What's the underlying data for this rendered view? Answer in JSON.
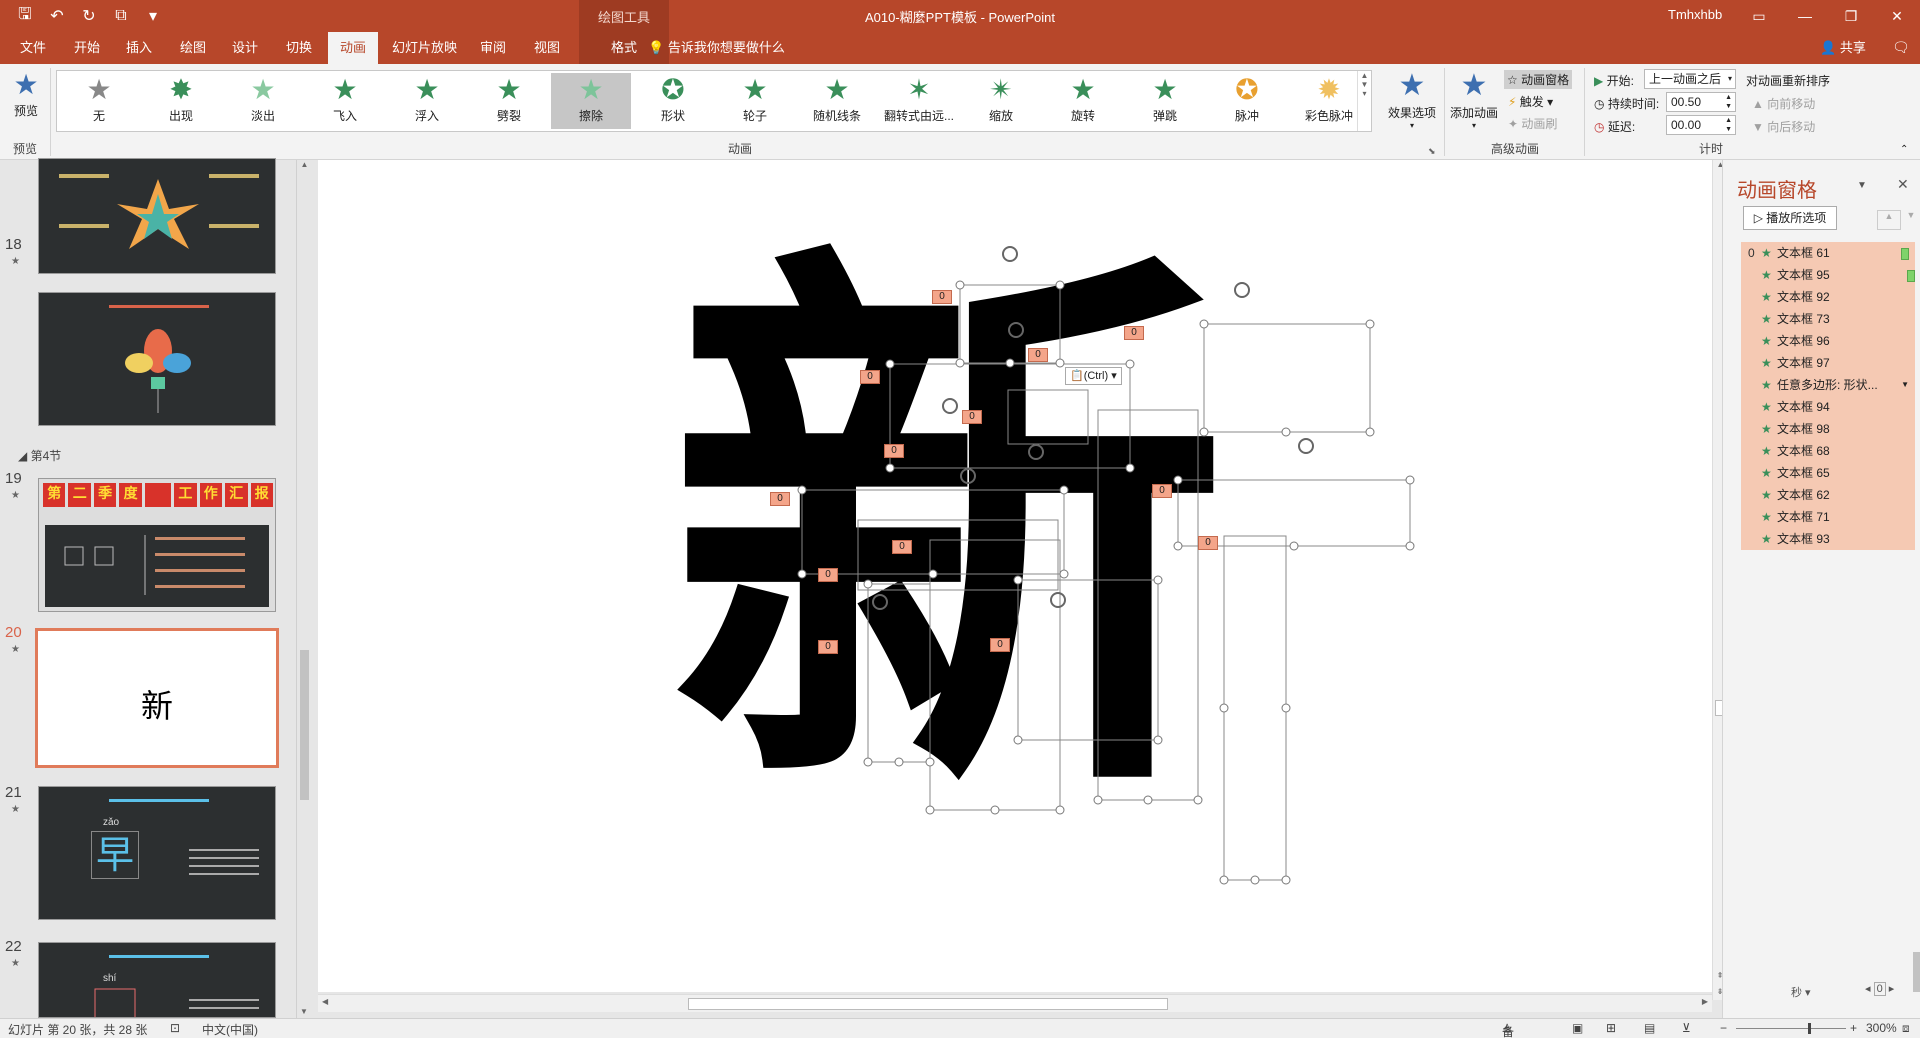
{
  "titlebar": {
    "context_tools": "绘图工具",
    "title": "A010-糊麼PPT模板 - PowerPoint",
    "user": "Tmhxhbb"
  },
  "tabs": [
    "文件",
    "开始",
    "插入",
    "绘图",
    "设计",
    "切换",
    "动画",
    "幻灯片放映",
    "审阅",
    "视图",
    "格式"
  ],
  "tell_me": "告诉我你想要做什么",
  "share": "共享",
  "ribbon": {
    "preview_label": "预览",
    "preview_group": "预览",
    "animation_group": "动画",
    "advanced_group": "高级动画",
    "timing_group": "计时",
    "gallery": [
      "无",
      "出现",
      "淡出",
      "飞入",
      "浮入",
      "劈裂",
      "擦除",
      "形状",
      "轮子",
      "随机线条",
      "翻转式由远...",
      "缩放",
      "旋转",
      "弹跳",
      "脉冲",
      "彩色脉冲"
    ],
    "selected_effect": "擦除",
    "effect_options": "效果选项",
    "add_animation": "添加动画",
    "animation_pane_btn": "动画窗格",
    "trigger": "触发",
    "animation_painter": "动画刷",
    "start_label": "开始:",
    "start_value": "上一动画之后",
    "duration_label": "持续时间:",
    "duration_value": "00.50",
    "delay_label": "延迟:",
    "delay_value": "00.00",
    "reorder_title": "对动画重新排序",
    "move_earlier": "向前移动",
    "move_later": "向后移动"
  },
  "slides": {
    "section": "第4节",
    "numbers": [
      "18",
      "19",
      "20",
      "21",
      "22"
    ],
    "current_slide_text": "新",
    "thumb_19_title": [
      "第",
      "二",
      "季",
      "度",
      "工",
      "作",
      "汇",
      "报"
    ],
    "thumb_21_char": "早",
    "thumb_21_pinyin": "zǎo",
    "thumb_22_pinyin": "shí"
  },
  "slide": {
    "character": "新",
    "ctrl_tag": "(Ctrl)",
    "anim_tag": "0"
  },
  "animation_pane": {
    "title": "动画窗格",
    "play_selected": "播放所选项",
    "first_index": "0",
    "items": [
      "文本框 61",
      "文本框 95",
      "文本框 92",
      "文本框 73",
      "文本框 96",
      "文本框 97",
      "任意多边形: 形状...",
      "文本框 94",
      "文本框 98",
      "文本框 68",
      "文本框 65",
      "文本框 62",
      "文本框 71",
      "文本框 93"
    ],
    "seconds_label": "秒",
    "zoom_index": "0"
  },
  "statusbar": {
    "slide_info": "幻灯片 第 20 张，共 28 张",
    "language": "中文(中国)",
    "notes": "备注",
    "zoom": "300%"
  },
  "colors": {
    "accent": "#b7472a",
    "ribbon_bg": "#f3f3f3",
    "anim_list_bg": "#f5c9b3",
    "tag_bg": "#f4a58a"
  }
}
